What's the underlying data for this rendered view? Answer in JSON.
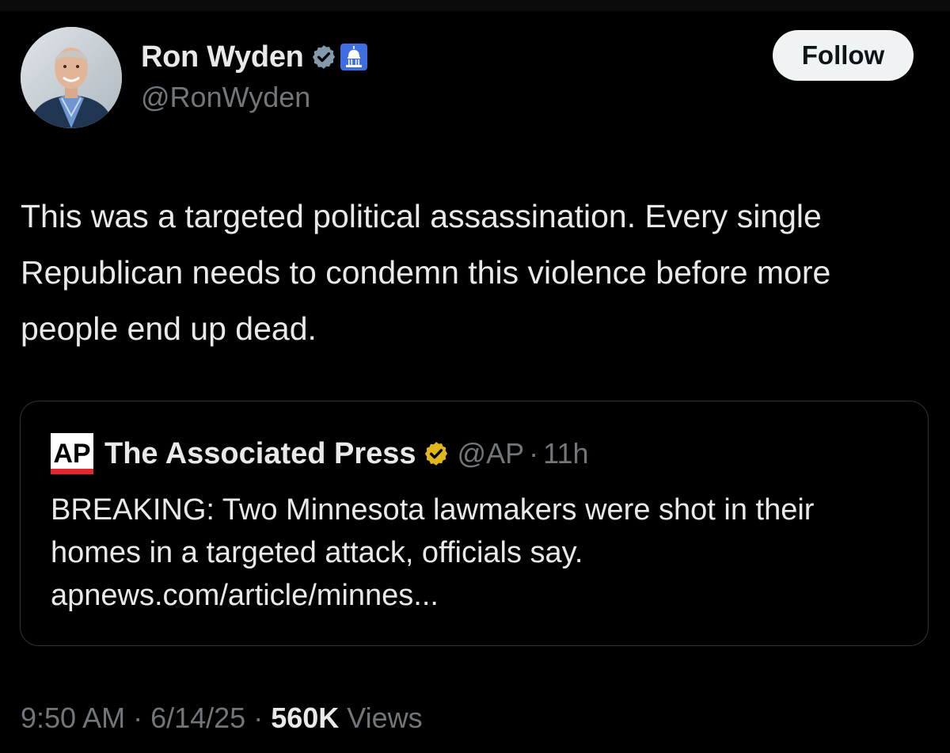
{
  "author": {
    "name": "Ron Wyden",
    "handle": "@RonWyden",
    "verified_badge_color": "#829aab",
    "affiliation_badge": "capitol-icon"
  },
  "follow_button": {
    "label": "Follow"
  },
  "tweet": {
    "text": "This was a targeted political assassination. Every single Republican needs to condemn this violence before more people end up dead."
  },
  "quote": {
    "logo": "AP",
    "name": "The Associated Press",
    "verified_badge_color": "#e2b719",
    "handle": "@AP",
    "separator": "·",
    "time": "11h",
    "text": "BREAKING: Two Minnesota lawmakers were shot in their homes in a targeted attack, officials say.\napnews.com/article/minnes..."
  },
  "meta": {
    "time": "9:50 AM",
    "separator": "·",
    "date": "6/14/25",
    "views_count": "560K",
    "views_label": "Views"
  },
  "colors": {
    "background": "#000000",
    "primary_text": "#e7e9ea",
    "secondary_text": "#71767b",
    "card_border": "#2f3336",
    "follow_button_bg": "#eff3f4"
  }
}
